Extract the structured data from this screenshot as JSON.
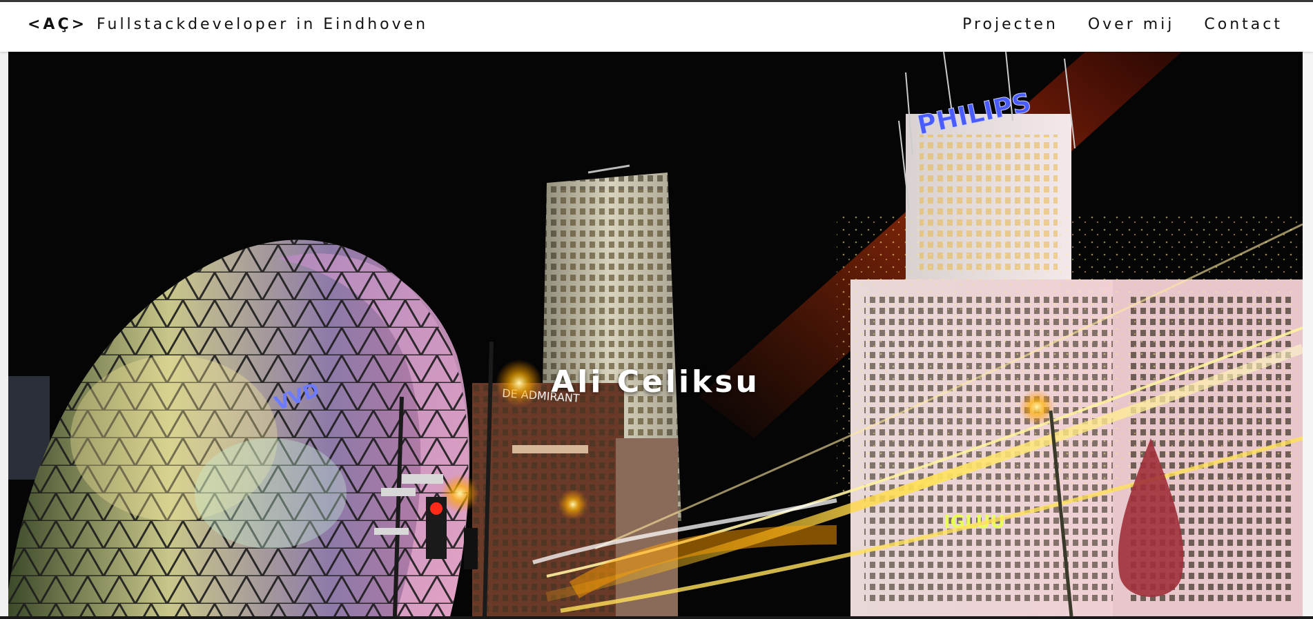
{
  "navbar": {
    "brand_logo": "<AÇ>",
    "brand_tagline": "Fullstackdeveloper in Eindhoven",
    "links": [
      {
        "label": "Projecten"
      },
      {
        "label": "Over mij"
      },
      {
        "label": "Contact"
      }
    ]
  },
  "hero": {
    "name": "Ali Celiksu",
    "image_signs": {
      "philips": "PHILIPS",
      "igluu": "IGLUU",
      "tower": "DE ADMIRANT"
    }
  },
  "colors": {
    "nav_background": "#ffffff",
    "nav_text": "#111111",
    "hero_text": "#ffffff",
    "sky": "#050505",
    "neon_blue": "#3a4bff",
    "neon_yellow": "#f0e04a",
    "light_trails": "#ffd54a"
  }
}
